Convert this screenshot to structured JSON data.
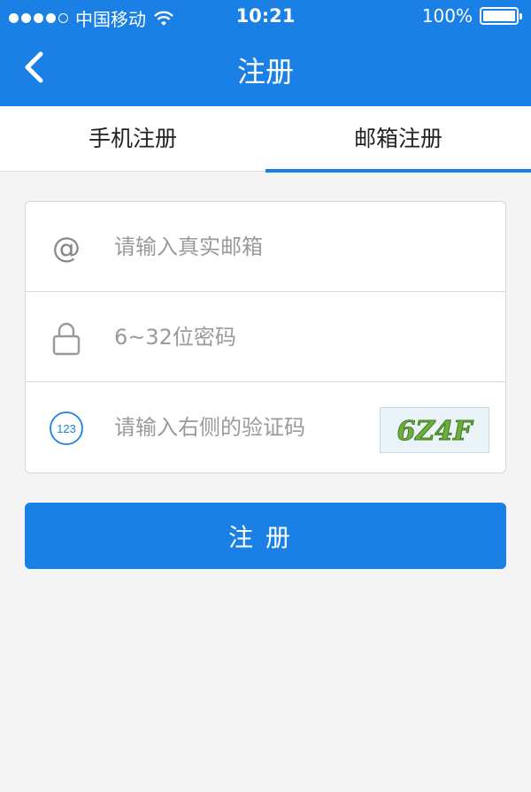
{
  "status_bar": {
    "carrier": "中国移动",
    "time": "10:21",
    "battery": "100%"
  },
  "nav": {
    "title": "注册",
    "back_icon": "chevron-left-icon"
  },
  "tabs": [
    {
      "label": "手机注册",
      "active": false
    },
    {
      "label": "邮箱注册",
      "active": true
    }
  ],
  "form": {
    "email": {
      "icon": "at-icon",
      "placeholder": "请输入真实邮箱",
      "value": ""
    },
    "password": {
      "icon": "lock-icon",
      "placeholder": "6~32位密码",
      "value": ""
    },
    "captcha": {
      "icon": "number-123-icon",
      "icon_text": "123",
      "placeholder": "请输入右侧的验证码",
      "value": "",
      "image_text": "6Z4F"
    }
  },
  "submit": {
    "label": "注册"
  },
  "colors": {
    "accent": "#1a80e6",
    "background": "#f4f4f4",
    "border": "#d6d6d6",
    "placeholder": "#9a9a9a"
  }
}
